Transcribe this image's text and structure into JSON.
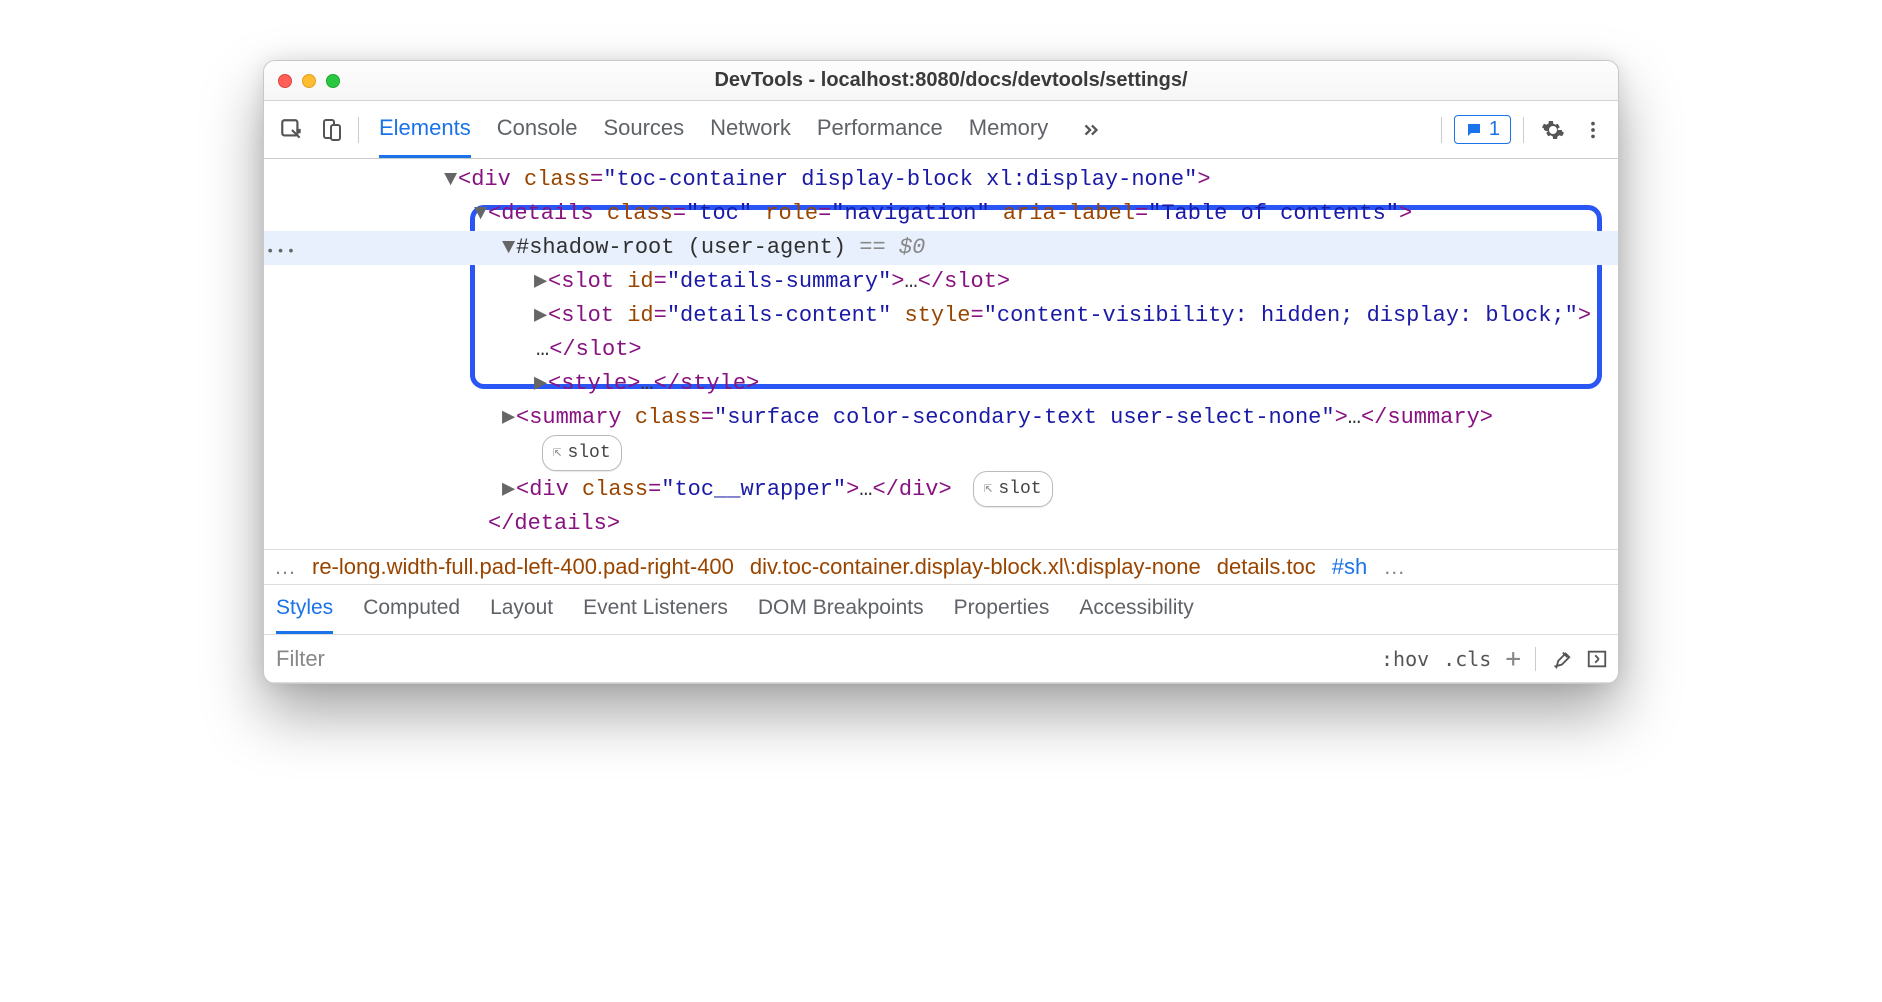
{
  "title": "DevTools - localhost:8080/docs/devtools/settings/",
  "toolbar": {
    "tabs": [
      "Elements",
      "Console",
      "Sources",
      "Network",
      "Performance",
      "Memory"
    ],
    "active_index": 0,
    "feedback_count": "1"
  },
  "dom": {
    "l1_caret": "▼",
    "l1_tag": "div",
    "l1_attr": "class",
    "l1_val": "toc-container display-block xl:display-none",
    "l2_caret": "▼",
    "l2_tag": "details",
    "l2_attr1": "class",
    "l2_val1": "toc",
    "l2_attr2": "role",
    "l2_val2": "navigation",
    "l2_attr3": "aria-label",
    "l2_val3": "Table of contents",
    "l3_caret": "▼",
    "l3_text": "#shadow-root (user-agent)",
    "l3_eq": " == ",
    "l3_dollar": "$0",
    "sl1_caret": "▶",
    "sl1_tag": "slot",
    "sl1_attr": "id",
    "sl1_val": "details-summary",
    "sl1_ell": "…",
    "sl2_caret": "▶",
    "sl2_tag": "slot",
    "sl2_attr1": "id",
    "sl2_val1": "details-content",
    "sl2_attr2": "style",
    "sl2_val2": "content-visibility: hidden; display: block;",
    "sl2_ell": "…",
    "st_caret": "▶",
    "st_tag": "style",
    "st_ell": "…",
    "sum_caret": "▶",
    "sum_tag": "summary",
    "sum_attr": "class",
    "sum_val": "surface color-secondary-text user-select-none",
    "sum_ell": "…",
    "slot_badge": "slot",
    "wrap_caret": "▶",
    "wrap_tag": "div",
    "wrap_attr": "class",
    "wrap_val": "toc__wrapper",
    "wrap_ell": "…",
    "close_tag": "details"
  },
  "crumbs": {
    "ell_l": "…",
    "c1": "re-long.width-full.pad-left-400.pad-right-400",
    "c2": "div.toc-container.display-block.xl\\:display-none",
    "c3": "details.toc",
    "c4": "#sh",
    "ell_r": "…"
  },
  "subtabs": [
    "Styles",
    "Computed",
    "Layout",
    "Event Listeners",
    "DOM Breakpoints",
    "Properties",
    "Accessibility"
  ],
  "subtab_active": 0,
  "filter": {
    "placeholder": "Filter",
    "hov": ":hov",
    "cls": ".cls"
  }
}
